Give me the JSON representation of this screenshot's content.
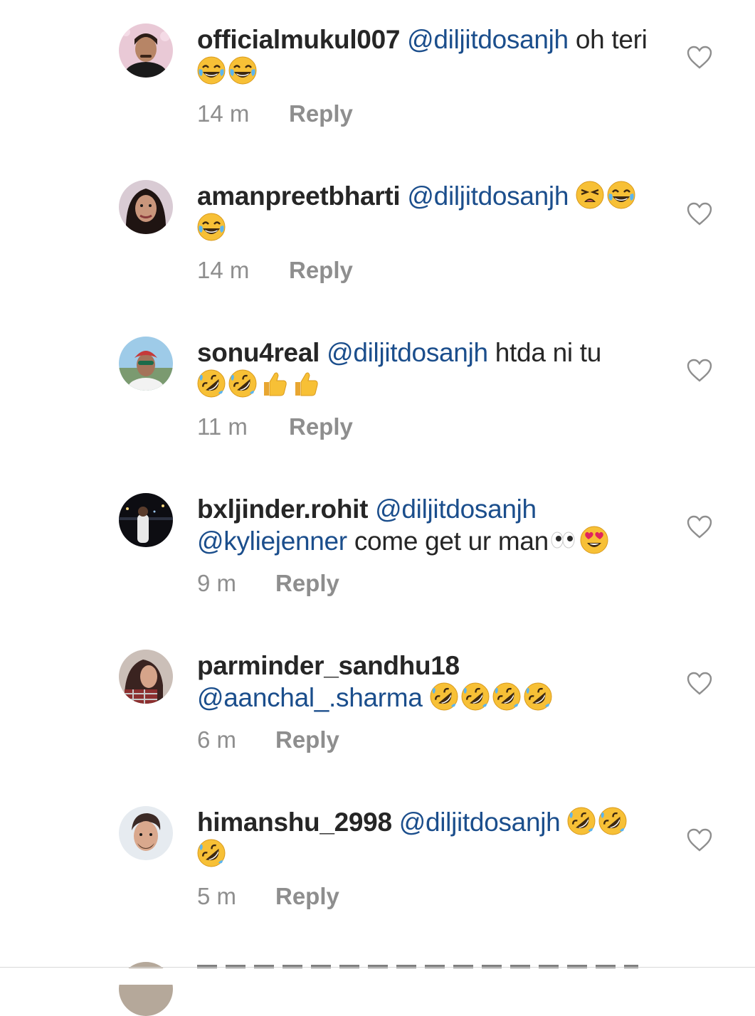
{
  "comments": [
    {
      "username": "officialmukul007",
      "mentions": [
        "@diljitdosanjh"
      ],
      "text": "oh teri",
      "emojis": [
        "face-with-tears-of-joy-icon",
        "face-with-tears-of-joy-icon"
      ],
      "time": "14 m",
      "reply_label": "Reply"
    },
    {
      "username": "amanpreetbharti",
      "mentions": [
        "@diljitdosanjh"
      ],
      "text": "",
      "emojis": [
        "weary-face-icon",
        "face-with-tears-of-joy-icon",
        "face-with-tears-of-joy-icon"
      ],
      "time": "14 m",
      "reply_label": "Reply"
    },
    {
      "username": "sonu4real",
      "mentions": [
        "@diljitdosanjh"
      ],
      "text": "htda ni tu",
      "emojis": [
        "rolling-on-floor-laughing-icon",
        "rolling-on-floor-laughing-icon",
        "thumbs-up-icon",
        "thumbs-up-icon"
      ],
      "time": "11 m",
      "reply_label": "Reply"
    },
    {
      "username": "bxljinder.rohit",
      "mentions": [
        "@diljitdosanjh",
        "@kyliejenner"
      ],
      "text": "come get ur man",
      "emojis": [
        "eyes-icon",
        "heart-eyes-icon"
      ],
      "time": "9 m",
      "reply_label": "Reply"
    },
    {
      "username": "parminder_sandhu18",
      "mentions": [
        "@aanchal_.sharma"
      ],
      "text": "",
      "emojis": [
        "rolling-on-floor-laughing-icon",
        "rolling-on-floor-laughing-icon",
        "rolling-on-floor-laughing-icon",
        "rolling-on-floor-laughing-icon"
      ],
      "time": "6 m",
      "reply_label": "Reply"
    },
    {
      "username": "himanshu_2998",
      "mentions": [
        "@diljitdosanjh"
      ],
      "text": "",
      "emojis": [
        "rolling-on-floor-laughing-icon",
        "rolling-on-floor-laughing-icon",
        "rolling-on-floor-laughing-icon"
      ],
      "time": "5 m",
      "reply_label": "Reply"
    }
  ],
  "colors": {
    "text": "#262626",
    "mention": "#1b4e8c",
    "meta": "#8e8e8e",
    "heart_outline": "#8e8e8e",
    "emoji_yellow": "#f7c036",
    "background": "#ffffff"
  }
}
